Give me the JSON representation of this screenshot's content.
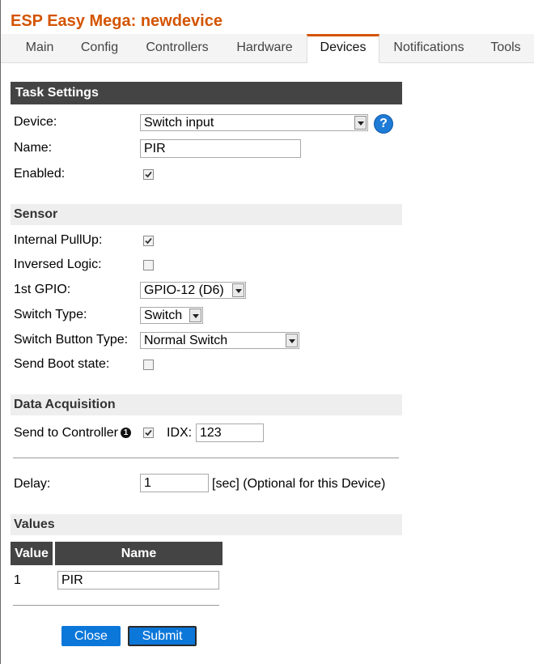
{
  "app": {
    "title": "ESP Easy Mega: newdevice"
  },
  "menu": {
    "tabs": [
      {
        "label": "Main"
      },
      {
        "label": "Config"
      },
      {
        "label": "Controllers"
      },
      {
        "label": "Hardware"
      },
      {
        "label": "Devices"
      },
      {
        "label": "Notifications"
      },
      {
        "label": "Tools"
      }
    ],
    "active": "Devices"
  },
  "task_settings": {
    "header": "Task Settings",
    "device_label": "Device:",
    "device_value": "Switch input",
    "help_glyph": "?",
    "name_label": "Name:",
    "name_value": "PIR",
    "enabled_label": "Enabled:",
    "enabled": true
  },
  "sensor": {
    "header": "Sensor",
    "pullup_label": "Internal PullUp:",
    "pullup": true,
    "inversed_label": "Inversed Logic:",
    "inversed": false,
    "gpio_label": "1st GPIO:",
    "gpio_value": "GPIO-12 (D6)",
    "switch_type_label": "Switch Type:",
    "switch_type_value": "Switch",
    "button_type_label": "Switch Button Type:",
    "button_type_value": "Normal Switch",
    "boot_state_label": "Send Boot state:",
    "boot_state": false
  },
  "data_acquisition": {
    "header": "Data Acquisition",
    "send_label": "Send to Controller",
    "info_glyph": "1",
    "send": true,
    "idx_label": "IDX:",
    "idx_value": "123",
    "delay_label": "Delay:",
    "delay_value": "1",
    "delay_unit": "[sec] (Optional for this Device)"
  },
  "values": {
    "header": "Values",
    "columns": [
      "Value",
      "Name"
    ],
    "rows": [
      {
        "index": "1",
        "name": "PIR"
      }
    ]
  },
  "buttons": {
    "close": "Close",
    "submit": "Submit"
  },
  "colors": {
    "accent": "#d35400",
    "header_dark": "#444444",
    "button": "#0b77d9"
  }
}
